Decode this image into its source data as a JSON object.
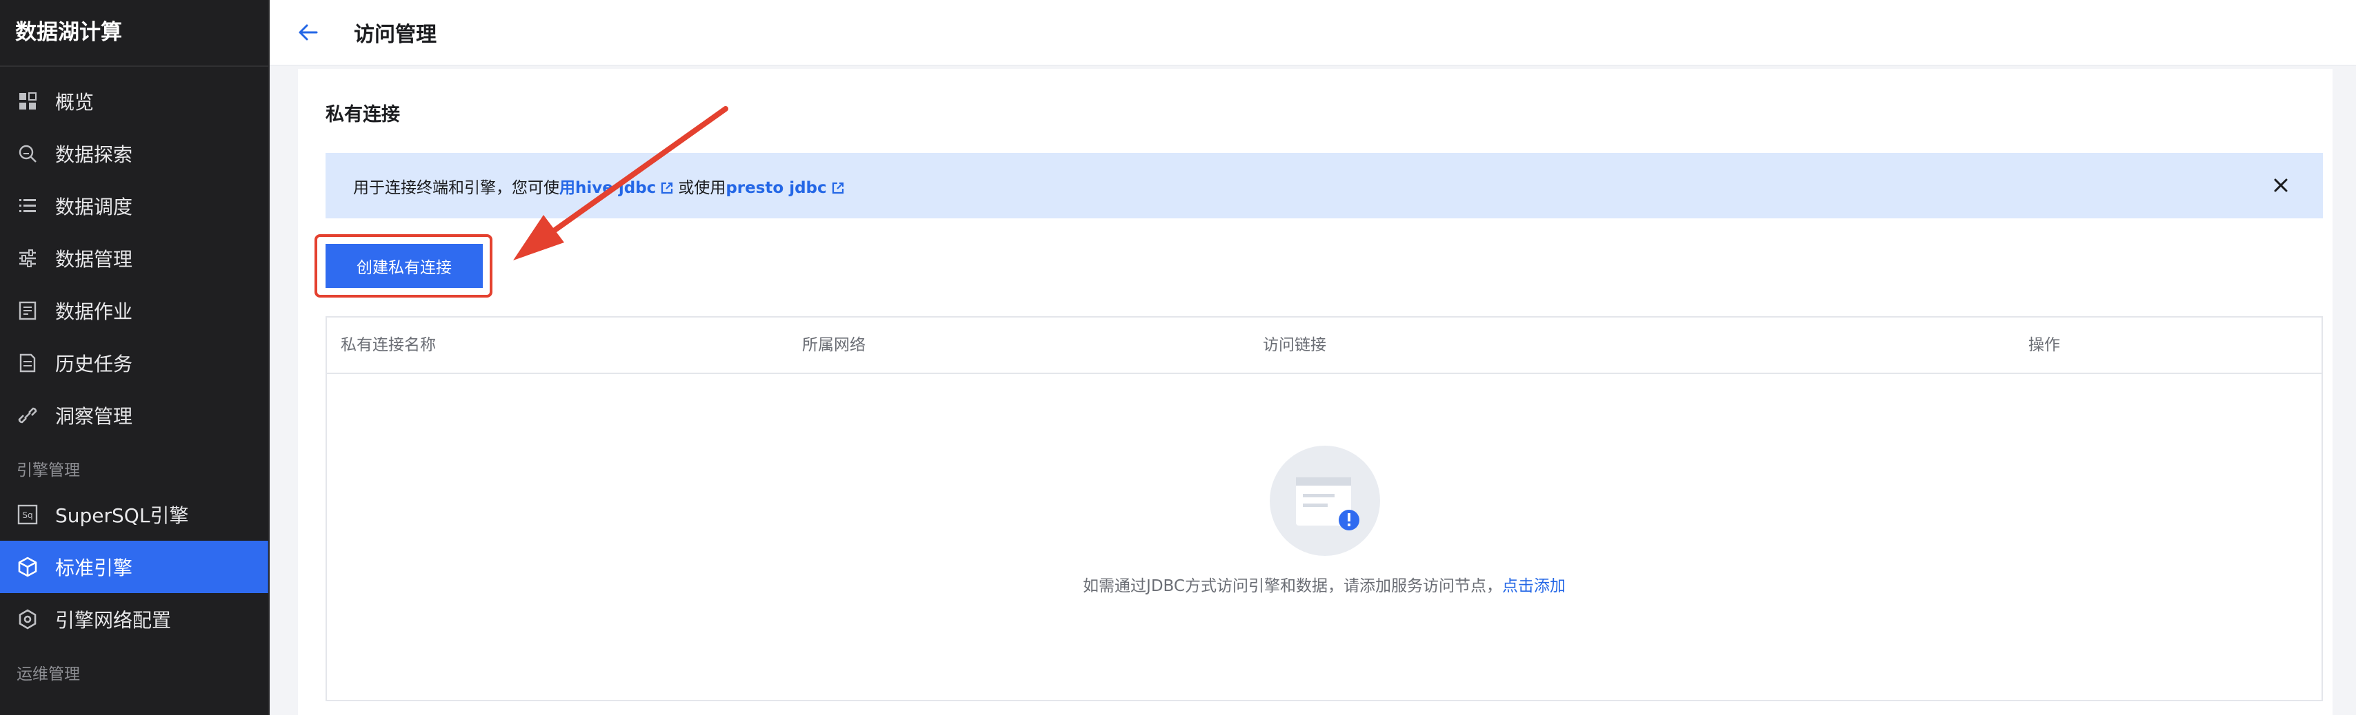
{
  "app": {
    "title": "数据湖计算"
  },
  "sidebar": {
    "items": [
      {
        "label": "概览",
        "icon": "dashboard-icon"
      },
      {
        "label": "数据探索",
        "icon": "search-data-icon"
      },
      {
        "label": "数据调度",
        "icon": "list-icon"
      },
      {
        "label": "数据管理",
        "icon": "sliders-icon"
      },
      {
        "label": "数据作业",
        "icon": "document-icon"
      },
      {
        "label": "历史任务",
        "icon": "history-doc-icon"
      },
      {
        "label": "洞察管理",
        "icon": "link-icon"
      }
    ],
    "group_engine": "引擎管理",
    "engine_items": [
      {
        "label": "SuperSQL引擎",
        "icon": "sql-icon"
      },
      {
        "label": "标准引擎",
        "icon": "cube-icon",
        "active": true
      },
      {
        "label": "引擎网络配置",
        "icon": "network-settings-icon"
      }
    ],
    "group_ops": "运维管理"
  },
  "header": {
    "title": "访问管理"
  },
  "main": {
    "section_title": "私有连接",
    "notice": {
      "prefix": "用于连接终端和引擎，您可使",
      "link1_hidden": "用",
      "link1": "hive jdbc",
      "middle": "或使用",
      "link2": "presto jdbc"
    },
    "create_button": "创建私有连接",
    "table": {
      "columns": [
        "私有连接名称",
        "所属网络",
        "访问链接",
        "操作"
      ],
      "rows": []
    },
    "empty": {
      "text": "如需通过JDBC方式访问引擎和数据，请添加服务访问节点，",
      "action": "点击添加"
    }
  },
  "colors": {
    "sidebar_bg": "#1f1f21",
    "accent": "#2f6bf0",
    "notice_bg": "#dbe8fd",
    "annotation_red": "#e4412f"
  }
}
